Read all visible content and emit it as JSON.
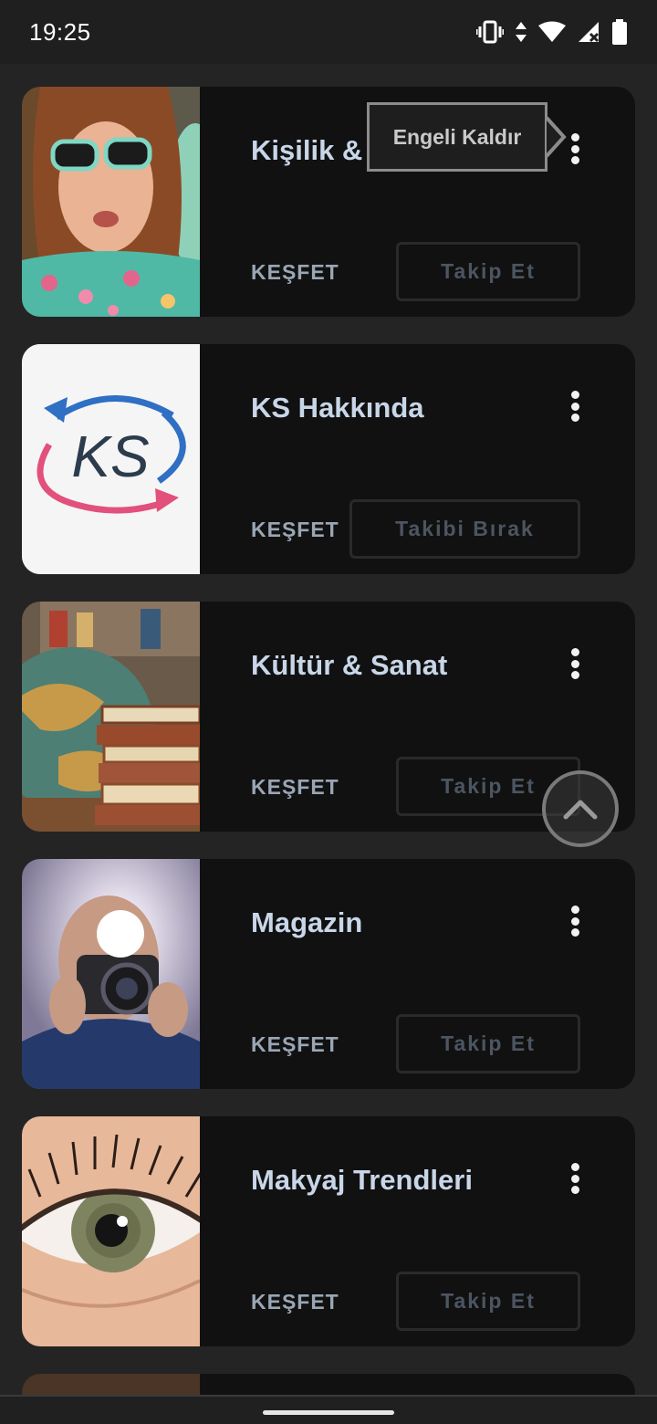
{
  "status_bar": {
    "time": "19:25",
    "icons": [
      "vibrate-icon",
      "data-arrows-icon",
      "wifi-icon",
      "signal-no-service-icon",
      "battery-icon"
    ]
  },
  "cards": [
    {
      "title": "Kişilik &",
      "explore": "KEŞFET",
      "follow": "Takip Et",
      "image": "woman-sunglasses-photo"
    },
    {
      "title": "KS Hakkında",
      "explore": "KEŞFET",
      "follow": "Takibi Bırak",
      "image": "ks-logo"
    },
    {
      "title": "Kültür & Sanat",
      "explore": "KEŞFET",
      "follow": "Takip Et",
      "image": "globe-books-photo"
    },
    {
      "title": "Magazin",
      "explore": "KEŞFET",
      "follow": "Takip Et",
      "image": "photographer-photo"
    },
    {
      "title": "Makyaj Trendleri",
      "explore": "KEŞFET",
      "follow": "Takip Et",
      "image": "eye-closeup-photo"
    }
  ],
  "tooltip": {
    "label": "Engeli Kaldır"
  },
  "logo_text": "KS",
  "colors": {
    "background": "#242424",
    "card": "#111111",
    "title": "#c8d6e8",
    "explore": "#9aa6b4",
    "follow_text": "#4c5561"
  }
}
